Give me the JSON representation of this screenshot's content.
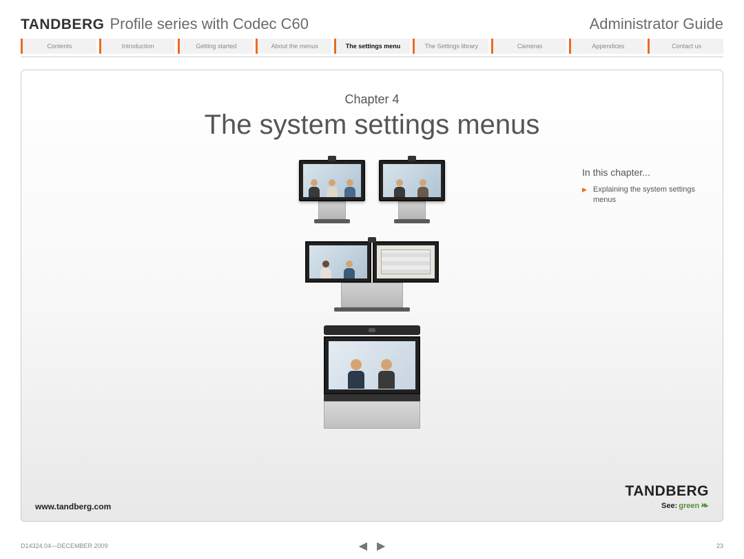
{
  "header": {
    "brand": "TANDBERG",
    "series": "Profile series with Codec C60",
    "guide": "Administrator Guide"
  },
  "tabs": [
    {
      "label": "Contents",
      "active": false
    },
    {
      "label": "Introduction",
      "active": false
    },
    {
      "label": "Getting started",
      "active": false
    },
    {
      "label": "About the menus",
      "active": false
    },
    {
      "label": "The settings menu",
      "active": true
    },
    {
      "label": "The Settings library",
      "active": false
    },
    {
      "label": "Cameras",
      "active": false
    },
    {
      "label": "Appendices",
      "active": false
    },
    {
      "label": "Contact us",
      "active": false
    }
  ],
  "chapter": {
    "label": "Chapter 4",
    "title": "The system settings menus"
  },
  "toc": {
    "heading": "In this chapter...",
    "items": [
      "Explaining the system settings menus"
    ]
  },
  "box_footer": {
    "website": "www.tandberg.com",
    "brand": "TANDBERG",
    "see_label": "See:",
    "green_label": "green"
  },
  "page_footer": {
    "docid": "D14324.04—DECEMBER 2009",
    "page_number": "23"
  }
}
